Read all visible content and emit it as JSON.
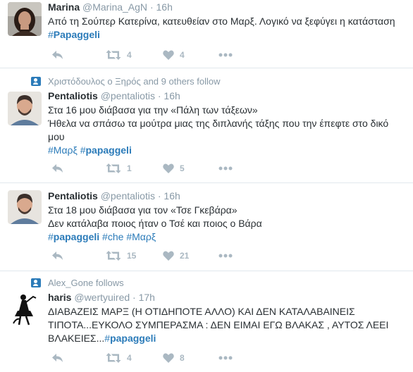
{
  "tweets": [
    {
      "context": "",
      "name": "Marina",
      "handle": "@Marina_AgN",
      "dot": "·",
      "time": "16h",
      "lines": [
        "Από τη Σούπερ Κατερίνα, κατευθείαν στο Μαρξ. Λογικό να ξεφύγει η κατάσταση"
      ],
      "tags": [
        {
          "hash": "#",
          "word": "Papaggeli",
          "bold": true
        }
      ],
      "retweets": "4",
      "likes": "4"
    },
    {
      "context": "Χριστόδουλος ο Ξηρός and 9 others follow",
      "name": "Pentaliotis",
      "handle": "@pentaliotis",
      "dot": "·",
      "time": "16h",
      "lines": [
        "Στα 16 μου διάβασα για την «Πάλη των τάξεων»",
        "Ήθελα να σπάσω τα μούτρα μιας της διπλανής τάξης που την έπεφτε στο δικό μου"
      ],
      "tags": [
        {
          "hash": "#",
          "word": "Μαρξ",
          "bold": false
        },
        {
          "hash": "#",
          "word": "papaggeli",
          "bold": true
        }
      ],
      "retweets": "1",
      "likes": "5"
    },
    {
      "context": "",
      "name": "Pentaliotis",
      "handle": "@pentaliotis",
      "dot": "·",
      "time": "16h",
      "lines": [
        "Στα 18 μου διάβασα για τον «Τσε Γκεβάρα»",
        "Δεν κατάλαβα ποιος ήταν ο Τσέ και ποιος ο Βάρα"
      ],
      "tags": [
        {
          "hash": "#",
          "word": "papaggeli",
          "bold": true
        },
        {
          "hash": "#",
          "word": "che",
          "bold": false
        },
        {
          "hash": "#",
          "word": "Μαρξ",
          "bold": false
        }
      ],
      "retweets": "15",
      "likes": "21"
    },
    {
      "context": "Alex_Gone follows",
      "name": "haris",
      "handle": "@wertyuired",
      "dot": "·",
      "time": "17h",
      "lines": [
        "ΔΙΑΒΑΖΕΙΣ ΜΑΡΞ (Η ΟΤΙΔΗΠΟΤΕ ΑΛΛΟ) ΚΑΙ ΔΕΝ ΚΑΤΑΛΑΒΑΙΝΕΙΣ",
        "ΤΙΠΟΤΑ...ΕΥΚΟΛΟ ΣΥΜΠΕΡΑΣΜΑ : ΔΕΝ ΕΙΜΑΙ ΕΓΩ ΒΛΑΚΑΣ , ΑΥΤΟΣ ΛΕΕΙ",
        "ΒΛΑΚΕΙΕΣ..."
      ],
      "tags": [
        {
          "hash": "#",
          "word": "papaggeli",
          "bold": true
        }
      ],
      "retweets": "4",
      "likes": "8"
    }
  ],
  "colors": {
    "link": "#2b7bb9",
    "muted": "#8899a6",
    "icon": "#aab8c2",
    "text": "#292f33",
    "divider": "#e1e8ed"
  },
  "icons": [
    "reply-icon",
    "retweet-icon",
    "heart-icon",
    "more-icon",
    "follow-context-icon"
  ]
}
